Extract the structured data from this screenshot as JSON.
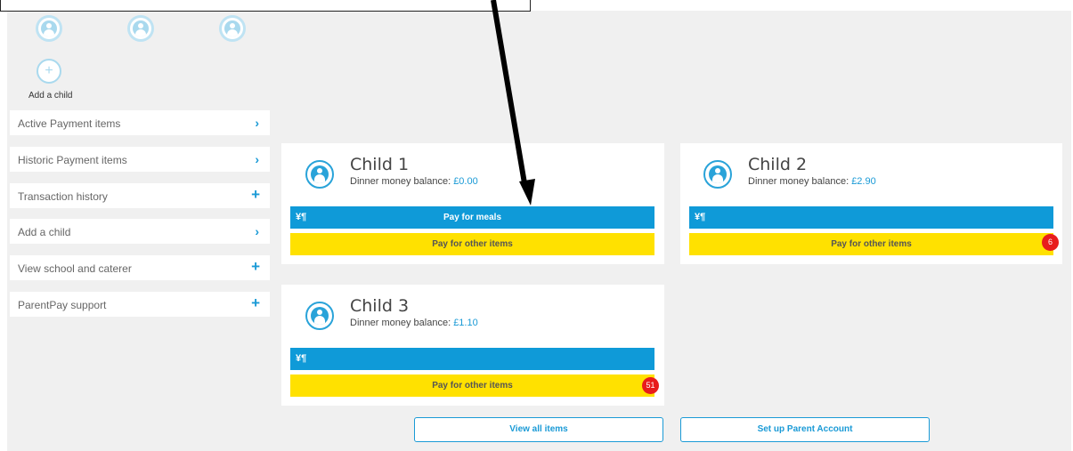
{
  "add_child_label": "Add a child",
  "add_symbol": "+",
  "menu": [
    {
      "label": "Active Payment items",
      "icon": "›"
    },
    {
      "label": "Historic Payment items",
      "icon": "›"
    },
    {
      "label": "Transaction history",
      "icon": "+"
    },
    {
      "label": "Add a child",
      "icon": "›"
    },
    {
      "label": "View school and caterer",
      "icon": "+"
    },
    {
      "label": "ParentPay support",
      "icon": "+"
    }
  ],
  "children": [
    {
      "name": "Child 1",
      "balance_label": "Dinner money balance:",
      "balance": "£0.00",
      "meals_label": "Pay for meals",
      "other_label": "Pay for other items",
      "badge": ""
    },
    {
      "name": "Child 2",
      "balance_label": "Dinner money balance:",
      "balance": "£2.90",
      "meals_label": "",
      "other_label": "Pay for other items",
      "badge": "6"
    },
    {
      "name": "Child 3",
      "balance_label": "Dinner money balance:",
      "balance": "£1.10",
      "meals_label": "",
      "other_label": "Pay for other items",
      "badge": "51"
    }
  ],
  "fork_glyph": "¥¶",
  "buttons": {
    "view_all": "View all items",
    "setup_parent": "Set up Parent Account"
  },
  "colors": {
    "blue": "#0f9ad8",
    "yellow": "#ffe100",
    "badge_red": "#e81c1c",
    "accent": "#1a9ad6"
  }
}
